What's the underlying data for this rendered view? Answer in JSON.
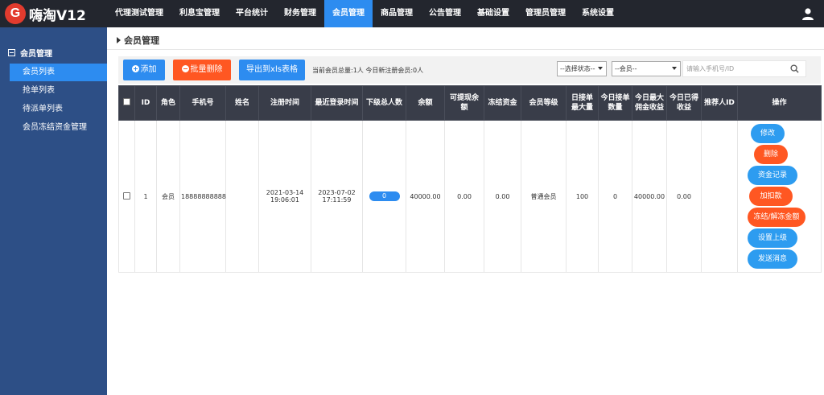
{
  "app": {
    "logo_letter": "G",
    "name": "嗨淘V12"
  },
  "topnav": [
    {
      "label": "代理测试管理",
      "active": false
    },
    {
      "label": "利息宝管理",
      "active": false
    },
    {
      "label": "平台统计",
      "active": false
    },
    {
      "label": "财务管理",
      "active": false
    },
    {
      "label": "会员管理",
      "active": true
    },
    {
      "label": "商品管理",
      "active": false
    },
    {
      "label": "公告管理",
      "active": false
    },
    {
      "label": "基础设置",
      "active": false
    },
    {
      "label": "管理员管理",
      "active": false
    },
    {
      "label": "系统设置",
      "active": false
    }
  ],
  "sidebar": {
    "section_title": "会员管理",
    "items": [
      {
        "label": "会员列表",
        "active": true
      },
      {
        "label": "抢单列表",
        "active": false
      },
      {
        "label": "待派单列表",
        "active": false
      },
      {
        "label": "会员冻结资金管理",
        "active": false
      }
    ]
  },
  "breadcrumb": "会员管理",
  "toolbar": {
    "add_label": "添加",
    "batch_delete_label": "批量删除",
    "export_label": "导出到xls表格",
    "stats_text": "当前会员总量:1人  今日新注册会员:0人",
    "status_select": "--选择状态--",
    "member_select": "--会员--",
    "search_placeholder": "请输入手机号/ID"
  },
  "table": {
    "headers": [
      "ID",
      "角色",
      "手机号",
      "姓名",
      "注册时间",
      "最近登录时间",
      "下级总人数",
      "余额",
      "可提现余额",
      "冻结资金",
      "会员等级",
      "日接单最大量",
      "今日接单数量",
      "今日最大佣金收益",
      "今日已得收益",
      "推荐人ID",
      "操作"
    ],
    "rows": [
      {
        "id": "1",
        "role": "会员",
        "phone": "18888888888",
        "name": "",
        "register_date": "2021-03-14",
        "register_time": "19:06:01",
        "login_date": "2023-07-02",
        "login_time": "17:11:59",
        "subordinates": "0",
        "balance": "40000.00",
        "withdrawable": "0.00",
        "frozen": "0.00",
        "level": "普通会员",
        "daily_max_orders": "100",
        "today_orders": "0",
        "today_max_commission": "40000.00",
        "today_earned": "0.00",
        "referrer_id": "",
        "actions": {
          "edit": "修改",
          "delete": "删除",
          "funds_record": "资金记录",
          "add_deduct": "加扣款",
          "freeze_unfreeze": "冻结/解冻金额",
          "set_superior": "设置上级",
          "send_message": "发送消息"
        }
      }
    ]
  },
  "colors": {
    "topbar_bg": "#23262e",
    "sidebar_bg": "#2d4f86",
    "accent_blue": "#2d8cf0",
    "accent_red": "#ff5722",
    "table_header_bg": "#393d49"
  }
}
